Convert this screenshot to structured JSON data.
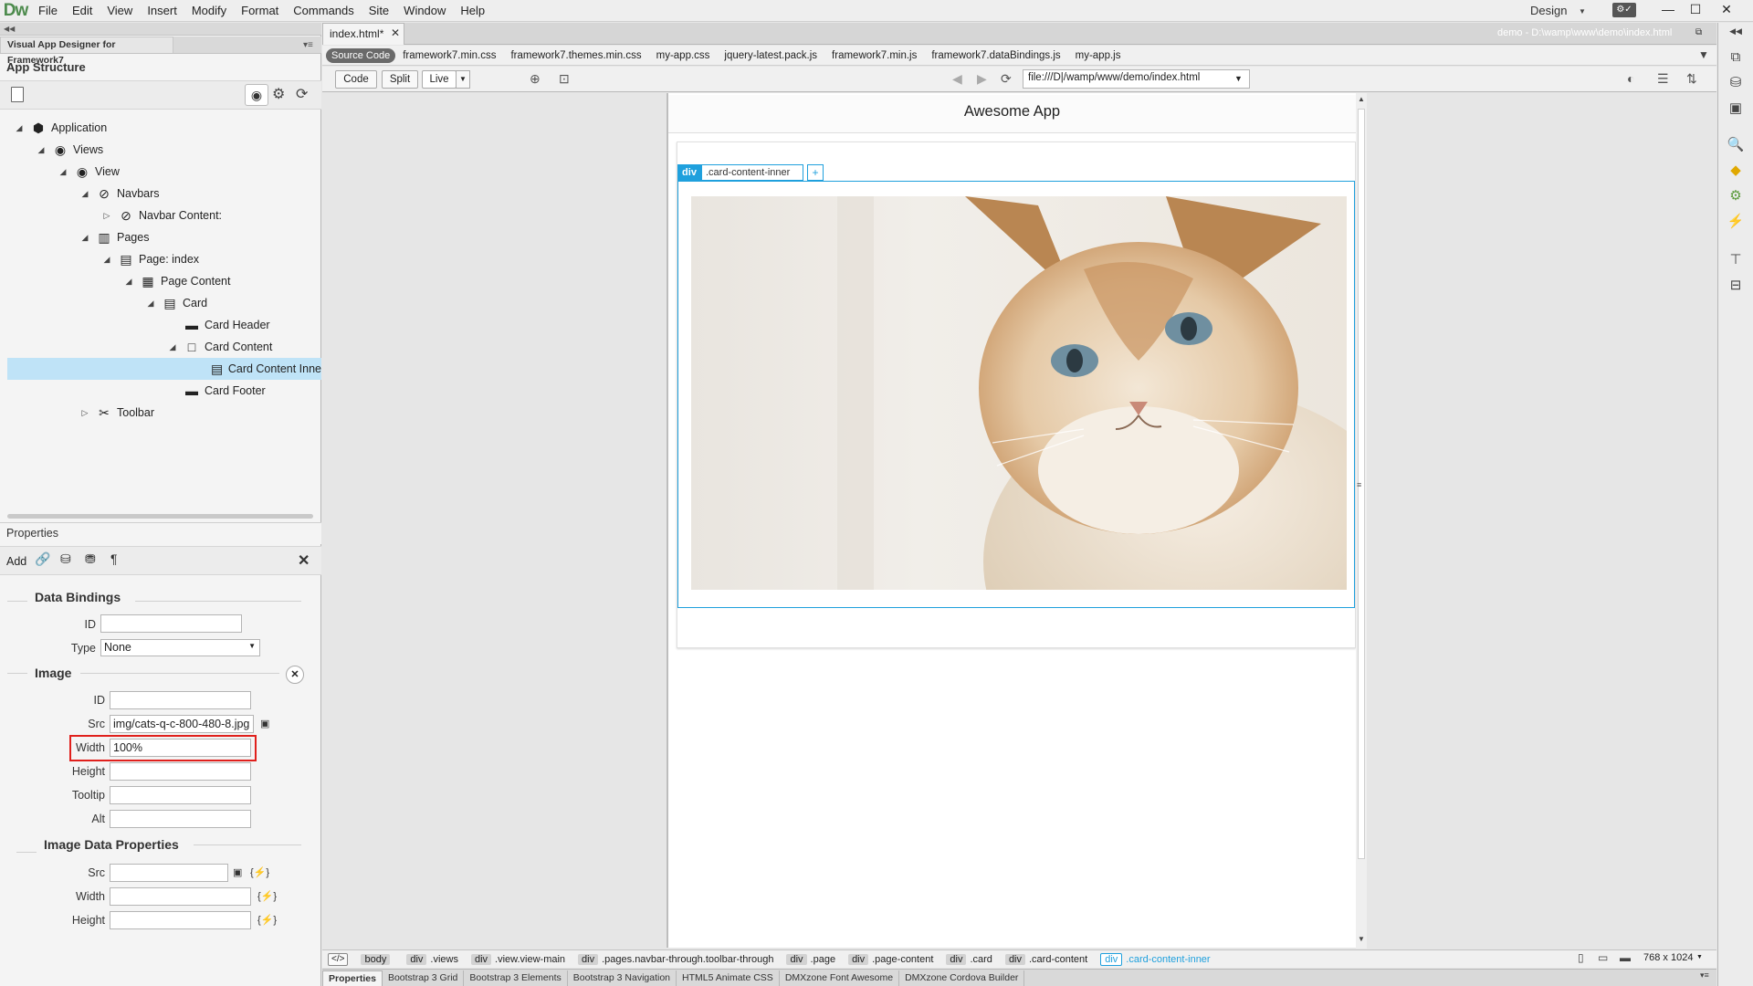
{
  "app": {
    "logo": "Dw",
    "menu": [
      "File",
      "Edit",
      "View",
      "Insert",
      "Modify",
      "Format",
      "Commands",
      "Site",
      "Window",
      "Help"
    ],
    "workspace": "Design"
  },
  "left_panel": {
    "tab_title": "Visual App Designer for Framework7",
    "structure_title": "App Structure",
    "tree": [
      {
        "label": "Application",
        "level": 0,
        "expanded": true,
        "icon": "cube-icon"
      },
      {
        "label": "Views",
        "level": 1,
        "expanded": true,
        "icon": "eye-icon"
      },
      {
        "label": "View",
        "level": 2,
        "expanded": true,
        "icon": "eye-icon"
      },
      {
        "label": "Navbars",
        "level": 3,
        "expanded": true,
        "icon": "compass-icon"
      },
      {
        "label": "Navbar Content:",
        "level": 4,
        "expanded": false,
        "icon": "compass-icon"
      },
      {
        "label": "Pages",
        "level": 3,
        "expanded": true,
        "icon": "book-icon"
      },
      {
        "label": "Page: index",
        "level": 4,
        "expanded": true,
        "icon": "page-icon"
      },
      {
        "label": "Page Content",
        "level": 5,
        "expanded": true,
        "icon": "page-content-icon"
      },
      {
        "label": "Card",
        "level": 6,
        "expanded": true,
        "icon": "card-icon"
      },
      {
        "label": "Card Header",
        "level": 7,
        "expanded": null,
        "icon": "dash-icon"
      },
      {
        "label": "Card Content",
        "level": 7,
        "expanded": true,
        "icon": "square-icon"
      },
      {
        "label": "Card Content Inne",
        "level": 8,
        "expanded": null,
        "icon": "card-icon",
        "selected": true
      },
      {
        "label": "Card Footer",
        "level": 7,
        "expanded": null,
        "icon": "dash-icon"
      },
      {
        "label": "Toolbar",
        "level": 3,
        "expanded": false,
        "icon": "tools-icon"
      }
    ],
    "properties": {
      "title": "Properties",
      "add_label": "Add",
      "data_bindings": {
        "title": "Data Bindings",
        "id_label": "ID",
        "id_value": "",
        "type_label": "Type",
        "type_value": "None"
      },
      "image": {
        "title": "Image",
        "id_label": "ID",
        "id_value": "",
        "src_label": "Src",
        "src_value": "img/cats-q-c-800-480-8.jpg",
        "width_label": "Width",
        "width_value": "100%",
        "height_label": "Height",
        "height_value": "",
        "tooltip_label": "Tooltip",
        "tooltip_value": "",
        "alt_label": "Alt",
        "alt_value": ""
      },
      "image_data": {
        "title": "Image Data Properties",
        "src_label": "Src",
        "width_label": "Width",
        "height_label": "Height",
        "binding_glyph": "{⚡}"
      }
    }
  },
  "document": {
    "tab": "index.html*",
    "path": "demo - D:\\wamp\\www\\demo\\index.html",
    "source_code_label": "Source Code",
    "related_files": [
      "framework7.min.css",
      "framework7.themes.min.css",
      "my-app.css",
      "jquery-latest.pack.js",
      "framework7.min.js",
      "framework7.dataBindings.js",
      "my-app.js"
    ],
    "view_buttons": {
      "code": "Code",
      "split": "Split",
      "live": "Live"
    },
    "address": "file:///D|/wamp/www/demo/index.html"
  },
  "canvas": {
    "navbar_title": "Awesome App",
    "selection_tag": "div",
    "selection_class": ".card-content-inner",
    "selection_add": "+"
  },
  "tag_selector": {
    "code_btn": "</>",
    "crumbs": [
      {
        "tag": "",
        "label": "body"
      },
      {
        "tag": "div",
        "label": ".views"
      },
      {
        "tag": "div",
        "label": ".view.view-main"
      },
      {
        "tag": "div",
        "label": ".pages.navbar-through.toolbar-through"
      },
      {
        "tag": "div",
        "label": ".page"
      },
      {
        "tag": "div",
        "label": ".page-content"
      },
      {
        "tag": "div",
        "label": ".card"
      },
      {
        "tag": "div",
        "label": ".card-content"
      },
      {
        "tag": "div",
        "label": ".card-content-inner",
        "active": true
      }
    ],
    "viewport": "768 x 1024"
  },
  "bottom_tabs": [
    "Properties",
    "Bootstrap 3 Grid",
    "Bootstrap 3 Elements",
    "Bootstrap 3 Navigation",
    "HTML5 Animate CSS",
    "DMXzone Font Awesome",
    "DMXzone Cordova Builder"
  ],
  "colors": {
    "accent": "#1fa0dd",
    "selection": "#bfe3f7",
    "highlight_box": "#e0201c"
  }
}
